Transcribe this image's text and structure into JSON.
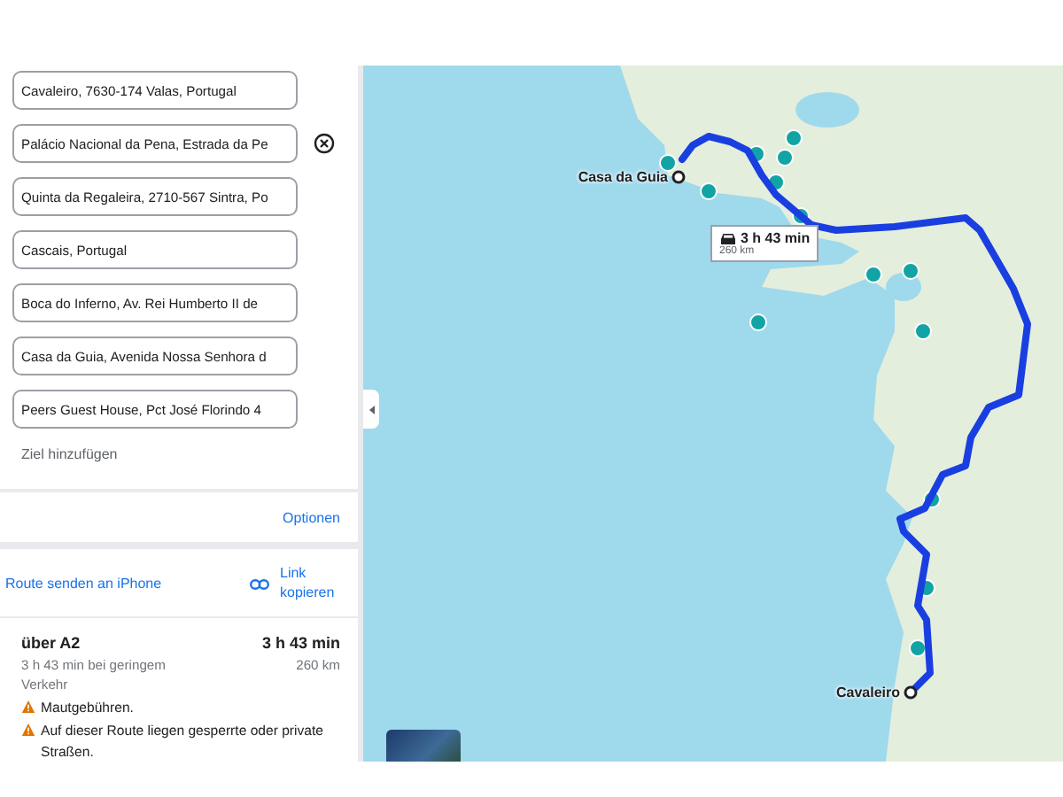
{
  "waypoints": [
    {
      "value": "Cavaleiro, 7630-174 Valas, Portugal",
      "removable": false
    },
    {
      "value": "Palácio Nacional da Pena, Estrada da Pe",
      "removable": true
    },
    {
      "value": "Quinta da Regaleira, 2710-567 Sintra, Po",
      "removable": false
    },
    {
      "value": "Cascais, Portugal",
      "removable": false
    },
    {
      "value": "Boca do Inferno, Av. Rei Humberto II de",
      "removable": false
    },
    {
      "value": "Casa da Guia, Avenida Nossa Senhora d",
      "removable": false
    },
    {
      "value": "Peers Guest House, Pct José Florindo 4",
      "removable": false
    }
  ],
  "add_destination": "Ziel hinzufügen",
  "options_link": "Optionen",
  "send_route": "Route senden an iPhone",
  "copy_link": "Link kopieren",
  "route": {
    "name": "über A2",
    "duration": "3 h 43 min",
    "detail": "3 h 43 min bei geringem Verkehr",
    "distance": "260 km",
    "warnings": [
      "Mautgebühren.",
      "Auf dieser Route liegen gesperrte oder private Straßen."
    ]
  },
  "map": {
    "route_callout": {
      "duration": "3 h 43 min",
      "distance": "260 km"
    },
    "markers": [
      {
        "label": "Casa da Guia"
      },
      {
        "label": "Cavaleiro"
      }
    ]
  }
}
